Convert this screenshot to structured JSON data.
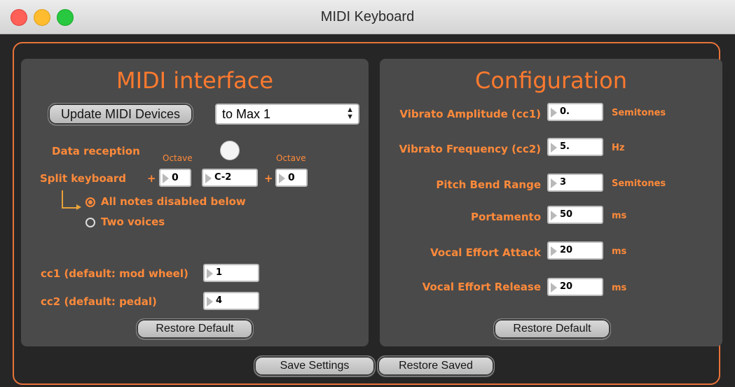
{
  "window": {
    "title": "MIDI Keyboard"
  },
  "colors": {
    "accent": "#ff7a2e",
    "panel": "#4a4a4a",
    "background": "#262626"
  },
  "midi_interface": {
    "title": "MIDI interface",
    "update_button": "Update MIDI Devices",
    "device_select": {
      "value": "to Max 1"
    },
    "data_reception_label": "Data reception",
    "octave_label_left": "Octave",
    "octave_label_right": "Octave",
    "split_keyboard_label": "Split keyboard",
    "plus_left": "+",
    "plus_right": "+",
    "octave_left_value": "0",
    "split_note_value": "C-2",
    "octave_right_value": "0",
    "radio_options": [
      {
        "label": "All notes disabled below",
        "selected": true
      },
      {
        "label": "Two voices",
        "selected": false
      }
    ],
    "cc1_label": "cc1 (default: mod wheel)",
    "cc1_value": "1",
    "cc2_label": "cc2 (default: pedal)",
    "cc2_value": "4",
    "restore_default": "Restore Default"
  },
  "configuration": {
    "title": "Configuration",
    "rows": [
      {
        "label": "Vibrato Amplitude (cc1)",
        "value": "0.",
        "unit": "Semitones"
      },
      {
        "label": "Vibrato Frequency (cc2)",
        "value": "5.",
        "unit": "Hz"
      },
      {
        "label": "Pitch Bend Range",
        "value": "3",
        "unit": "Semitones"
      },
      {
        "label": "Portamento",
        "value": "50",
        "unit": "ms"
      },
      {
        "label": "Vocal Effort Attack",
        "value": "20",
        "unit": "ms"
      },
      {
        "label": "Vocal Effort Release",
        "value": "20",
        "unit": "ms"
      }
    ],
    "restore_default": "Restore Default"
  },
  "footer": {
    "save_settings": "Save Settings",
    "restore_saved": "Restore Saved"
  }
}
